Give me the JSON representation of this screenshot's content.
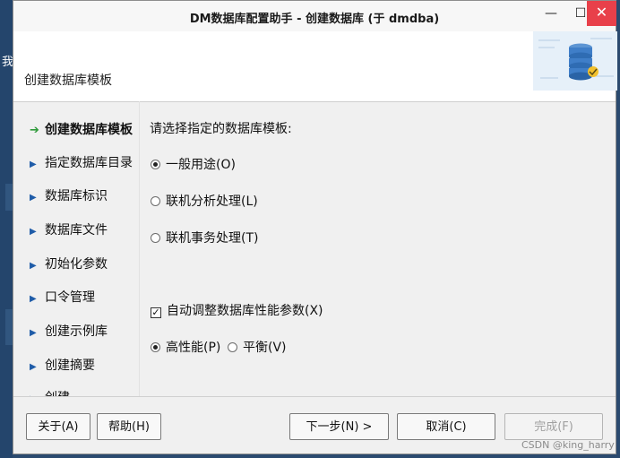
{
  "desktop": {
    "side_text": "我"
  },
  "window": {
    "title": "DM数据库配置助手 - 创建数据库 (于 dmdba)",
    "controls": {
      "minimize": "—",
      "maximize": "☐",
      "close": "✕"
    }
  },
  "header": {
    "title": "创建数据库模板"
  },
  "nav": {
    "items": [
      {
        "label": "创建数据库模板",
        "active": true
      },
      {
        "label": "指定数据库目录"
      },
      {
        "label": "数据库标识"
      },
      {
        "label": "数据库文件"
      },
      {
        "label": "初始化参数"
      },
      {
        "label": "口令管理"
      },
      {
        "label": "创建示例库"
      },
      {
        "label": "创建摘要"
      },
      {
        "label": "创建"
      }
    ]
  },
  "main": {
    "prompt": "请选择指定的数据库模板:",
    "templates": [
      {
        "label": "一般用途(O)",
        "selected": true
      },
      {
        "label": "联机分析处理(L)",
        "selected": false
      },
      {
        "label": "联机事务处理(T)",
        "selected": false
      }
    ],
    "auto_tune": {
      "label": "自动调整数据库性能参数(X)",
      "checked": true
    },
    "perf_mode": [
      {
        "label": "高性能(P)",
        "selected": true
      },
      {
        "label": "平衡(V)",
        "selected": false
      }
    ]
  },
  "buttons": {
    "about": "关于(A)",
    "help": "帮助(H)",
    "next": "下一步(N) >",
    "cancel": "取消(C)",
    "finish": "完成(F)"
  },
  "watermark": "CSDN @king_harry",
  "colors": {
    "close_red": "#e8404a",
    "current_arrow": "#2e9a3a",
    "nav_arrow": "#1f5ca8"
  }
}
